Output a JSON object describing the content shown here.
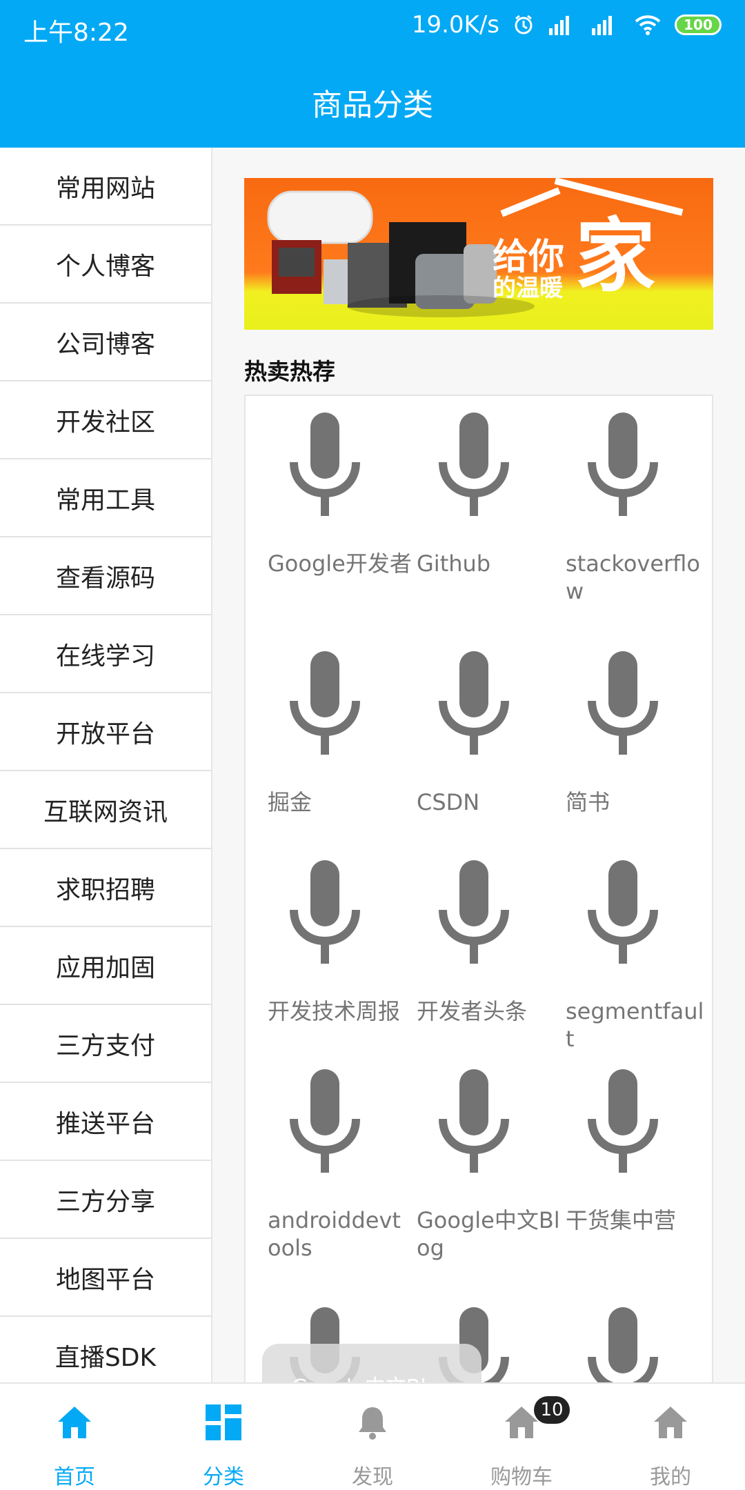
{
  "status_bar": {
    "time": "上午8:22",
    "speed": "19.0K/s",
    "battery": "100"
  },
  "header": {
    "title": "商品分类"
  },
  "sidebar": {
    "items": [
      {
        "label": "常用网站"
      },
      {
        "label": "个人博客"
      },
      {
        "label": "公司博客"
      },
      {
        "label": "开发社区"
      },
      {
        "label": "常用工具"
      },
      {
        "label": "查看源码"
      },
      {
        "label": "在线学习"
      },
      {
        "label": "开放平台"
      },
      {
        "label": "互联网资讯"
      },
      {
        "label": "求职招聘"
      },
      {
        "label": "应用加固"
      },
      {
        "label": "三方支付"
      },
      {
        "label": "推送平台"
      },
      {
        "label": "三方分享"
      },
      {
        "label": "地图平台"
      },
      {
        "label": "直播SDK"
      }
    ]
  },
  "banner": {
    "text_1": "给你",
    "text_2": "的温暖",
    "text_3": "家"
  },
  "content": {
    "section_title": "热卖热荐",
    "grid_items": [
      {
        "label": "Google开发者",
        "icon": "mic-icon"
      },
      {
        "label": "Github",
        "icon": "mic-icon"
      },
      {
        "label": "stackoverflow",
        "icon": "mic-icon"
      },
      {
        "label": "掘金",
        "icon": "mic-icon"
      },
      {
        "label": "CSDN",
        "icon": "mic-icon"
      },
      {
        "label": "简书",
        "icon": "mic-icon"
      },
      {
        "label": "开发技术周报",
        "icon": "mic-icon"
      },
      {
        "label": "开发者头条",
        "icon": "mic-icon"
      },
      {
        "label": "segmentfault",
        "icon": "mic-icon"
      },
      {
        "label": "androiddevtools",
        "icon": "mic-icon"
      },
      {
        "label": "Google中文Blog",
        "icon": "mic-icon"
      },
      {
        "label": "干货集中营",
        "icon": "mic-icon"
      },
      {
        "label": "",
        "icon": "mic-icon"
      },
      {
        "label": "",
        "icon": "mic-icon"
      },
      {
        "label": "",
        "icon": "mic-icon"
      }
    ]
  },
  "toast": {
    "text": "Google中文Blog"
  },
  "bottom_nav": {
    "items": [
      {
        "label": "首页",
        "icon": "home-icon"
      },
      {
        "label": "分类",
        "icon": "category-icon"
      },
      {
        "label": "发现",
        "icon": "bell-icon"
      },
      {
        "label": "购物车",
        "icon": "cart-home-icon"
      },
      {
        "label": "我的",
        "icon": "profile-home-icon"
      }
    ],
    "cart_badge": "10"
  },
  "colors": {
    "primary": "#03a9f4",
    "inactive": "#999999",
    "mic": "#737373",
    "badge": "#222222"
  }
}
